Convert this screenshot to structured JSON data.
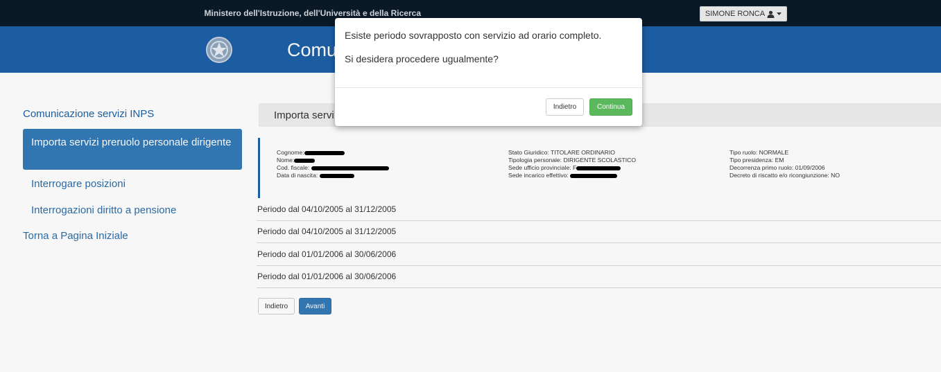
{
  "topbar": {
    "ministry": "Ministero dell'Istruzione, dell'Università e della Ricerca",
    "user": "SIMONE RONCA",
    "user_icon": "user-icon",
    "caret_icon": "caret-down-icon"
  },
  "header": {
    "title": "Comu",
    "emblem_icon": "italian-republic-emblem-icon"
  },
  "sidebar": {
    "section_title": "Comunicazione servizi INPS",
    "items": [
      {
        "label": "Importa servizi preruolo personale dirigente"
      },
      {
        "label": "Interrogare posizioni"
      },
      {
        "label": "Interrogazioni diritto a pensione"
      }
    ],
    "back_label": "Torna a Pagina Iniziale"
  },
  "main": {
    "panel_title": "Importa servi",
    "info": {
      "col1": [
        {
          "label": "Cognome:"
        },
        {
          "label": "Nome:"
        },
        {
          "label": "Cod. fiscale:"
        },
        {
          "label": "Data di nascita:"
        }
      ],
      "col2": [
        {
          "text": "Stato Giuridico: TITOLARE ORDINARIO"
        },
        {
          "text": "Tipologia personale: DIRIGENTE SCOLASTICO"
        },
        {
          "label": "Sede ufficio provinciale:",
          "prefix": "F"
        },
        {
          "label": "Sede incarico effettivo:"
        }
      ],
      "col3": [
        {
          "text": "Tipo ruolo: NORMALE"
        },
        {
          "text": "Tipo presidenza: EM"
        },
        {
          "text": "Decorrenza primo ruolo: 01/09/2006"
        },
        {
          "text": "Decreto di riscatto e/o ricongiunzione: NO"
        }
      ]
    },
    "periods": [
      "Periodo dal 04/10/2005 al 31/12/2005",
      "Periodo dal 04/10/2005 al 31/12/2005",
      "Periodo dal 01/01/2006 al 30/06/2006",
      "Periodo dal 01/01/2006 al 30/06/2006"
    ],
    "back_button": "Indietro",
    "next_button": "Avanti"
  },
  "modal": {
    "line1": "Esiste periodo sovrapposto con servizio ad orario completo.",
    "line2": "Si desidera procedere ugualmente?",
    "back_button": "Indietro",
    "continue_button": "Continua"
  },
  "colors": {
    "topbar": "#0b1a2a",
    "header": "#1d5fa7",
    "primary": "#337ab7",
    "success": "#5cb85c"
  }
}
